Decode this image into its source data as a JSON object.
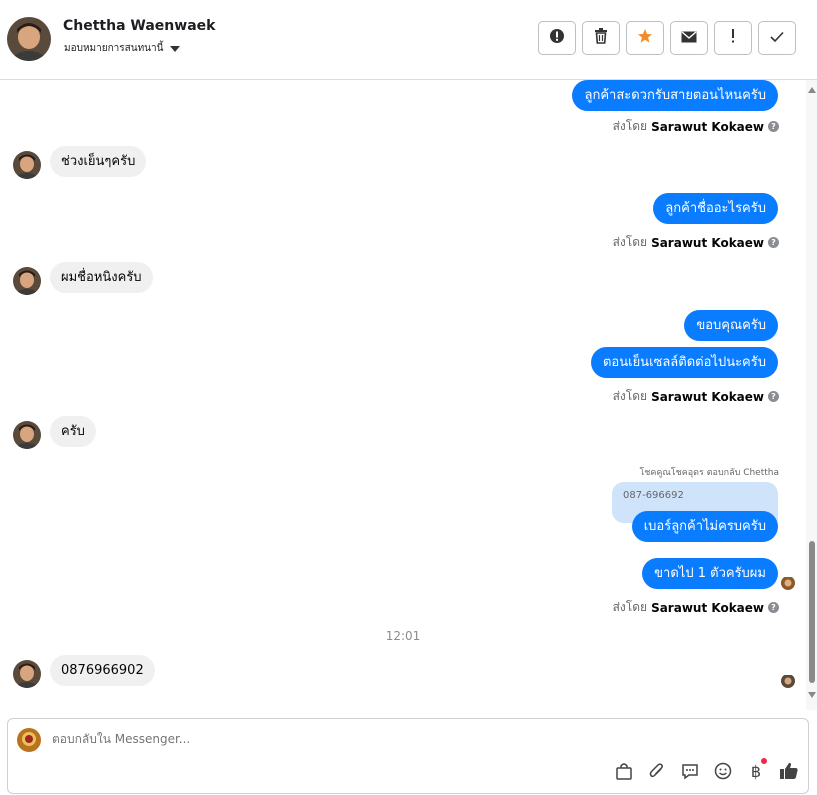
{
  "header": {
    "contact_name": "Chettha Waenwaek",
    "assign_label": "มอบหมายการสนทนานี้"
  },
  "toolbar": {
    "icons": [
      "exclamation-circle-icon",
      "trash-icon",
      "star-icon",
      "envelope-icon",
      "exclamation-icon",
      "check-icon"
    ],
    "symbols": [
      "!",
      "🗑",
      "★",
      "✉",
      "!",
      "✓"
    ]
  },
  "messages": {
    "m1": "ลูกค้าสะดวกรับสายตอนไหนครับ",
    "m2": "ช่วงเย็นๆครับ",
    "m3": "ลูกค้าชื่ออะไรครับ",
    "m4": "ผมชื่อหนิงครับ",
    "m5": "ขอบคุณครับ",
    "m6": "ตอนเย็นเซลล์ติดต่อไปนะครับ",
    "m7": "ครับ",
    "m8": "เบอร์ลูกค้าไม่ครบครับ",
    "m9": "ขาดไป 1 ตัวครับผม",
    "m10": "0876966902"
  },
  "sent_by": {
    "prefix": "ส่งโดย",
    "agent": "Sarawut Kokaew",
    "help_symbol": "?"
  },
  "reply": {
    "note": "โชคคูณโชคอุดร ตอบกลับ Chettha",
    "quoted_text": "087-696692"
  },
  "timestamp": "12:01",
  "composer": {
    "placeholder": "ตอบกลับใน Messenger...",
    "icons": [
      "bag-icon",
      "paperclip-icon",
      "chat-bubble-icon",
      "emoji-icon",
      "baht-icon",
      "thumbs-up-icon"
    ],
    "symbols": [
      "👜",
      "📎",
      "💬",
      "☺",
      "฿",
      "👍"
    ]
  },
  "colors": {
    "outgoing_bubble": "#0a7cff",
    "incoming_bubble": "#f0f0f0",
    "quote_bubble": "#cfe3fb",
    "star": "#f28c28"
  }
}
